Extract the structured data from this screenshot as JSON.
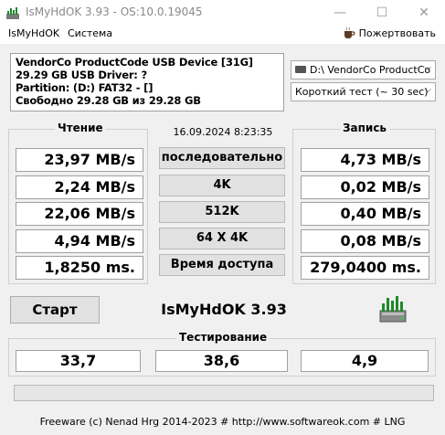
{
  "window": {
    "title": "IsMyHdOK 3.93 - OS:10.0.19045"
  },
  "titlebar_buttons": {
    "minimize": "—",
    "maximize": "☐",
    "close": "✕"
  },
  "menu": {
    "items": [
      "IsMyHdOK",
      "Система"
    ],
    "donate": "Пожертвовать"
  },
  "info": {
    "lines": [
      "VendorCo ProductCode USB Device [31G]",
      "29.29 GB  USB Driver: ?",
      "Partition: (D:) FAT32 - []",
      "Свободно 29.28 GB из 29.28 GB"
    ]
  },
  "selects": {
    "drive": "D:\\ VendorCo ProductCo",
    "test_mode": "Короткий тест (~ 30 sec)"
  },
  "read": {
    "label": "Чтение",
    "values": [
      "23,97 MB/s",
      "2,24 MB/s",
      "22,06 MB/s",
      "4,94 MB/s",
      "1,8250 ms."
    ]
  },
  "write": {
    "label": "Запись",
    "values": [
      "4,73 MB/s",
      "0,02 MB/s",
      "0,40 MB/s",
      "0,08 MB/s",
      "279,0400 ms."
    ]
  },
  "datetime": "16.09.2024 8:23:35",
  "tests": [
    "последовательно",
    "4K",
    "512K",
    "64 X 4K",
    "Время доступа"
  ],
  "start_label": "Старт",
  "app_name": "IsMyHdOK 3.93",
  "testing": {
    "label": "Тестирование",
    "values": [
      "33,7",
      "38,6",
      "4,9"
    ]
  },
  "progress_fraction": 0,
  "status": "Freeware (c) Nenad Hrg 2014-2023 # http://www.softwareok.com     # LNG",
  "colors": {
    "icon_green": "#1f8a2c",
    "icon_grey": "#8a8a8a"
  }
}
